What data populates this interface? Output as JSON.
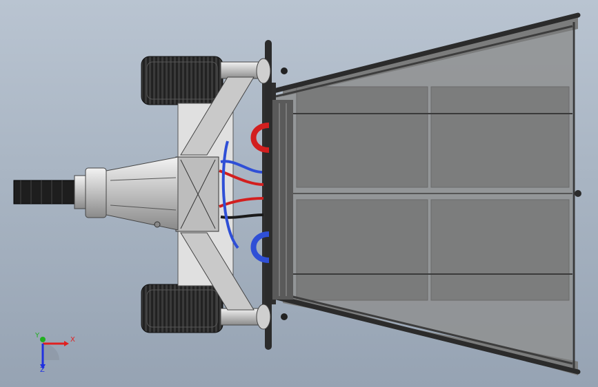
{
  "viewport": {
    "background_top": "#b9c4d1",
    "background_bottom": "#96a3b3"
  },
  "model": {
    "frame_color": "#2b2b2b",
    "panel_color": "#8f9090",
    "hose_red": "#d21f1f",
    "hose_blue": "#2f4fd6",
    "tire_color": "#1b1b1b"
  },
  "triad": {
    "x_label": "X",
    "y_label": "Y",
    "z_label": "Z",
    "x_color": "#e02020",
    "y_color": "#20b020",
    "z_color": "#2030e0"
  }
}
